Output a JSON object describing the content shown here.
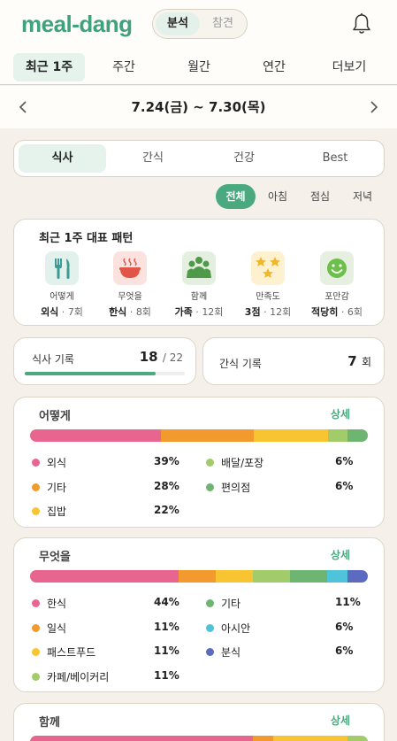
{
  "header": {
    "logo": "meal-dang",
    "mode_options": [
      "분석",
      "참견"
    ],
    "active_mode": "분석"
  },
  "period_tabs": [
    "최근 1주",
    "주간",
    "월간",
    "연간",
    "더보기"
  ],
  "date_range": "7.24(금) ~ 7.30(목)",
  "category_tabs": [
    "식사",
    "간식",
    "건강",
    "Best"
  ],
  "meal_filters": [
    "전체",
    "아침",
    "점심",
    "저녁"
  ],
  "pattern": {
    "title": "최근 1주 대표 패턴",
    "items": [
      {
        "label": "어떻게",
        "value": "외식",
        "count": "7회",
        "icon": "fork-knife-icon"
      },
      {
        "label": "무엇을",
        "value": "한식",
        "count": "8회",
        "icon": "soup-bowl-icon"
      },
      {
        "label": "함께",
        "value": "가족",
        "count": "12회",
        "icon": "family-icon"
      },
      {
        "label": "만족도",
        "value": "3점",
        "count": "12회",
        "icon": "stars-icon"
      },
      {
        "label": "포만감",
        "value": "적당히",
        "count": "6회",
        "icon": "smiley-icon"
      }
    ]
  },
  "meal_record": {
    "label": "식사 기록",
    "value": "18",
    "total": "/ 22",
    "progress": 0.82
  },
  "snack_record": {
    "label": "간식 기록",
    "value": "7",
    "unit": "회"
  },
  "colors": {
    "pink": "#e8658f",
    "orange": "#f29a2e",
    "yellow": "#f8c431",
    "lightgreen": "#a2cc6a",
    "green": "#6db570",
    "cyan": "#4fc3d9",
    "indigo": "#5c6bc0",
    "accent": "#4aa97f"
  },
  "sections": [
    {
      "title": "어떻게",
      "link": "상세",
      "items": [
        {
          "name": "외식",
          "pct": "39%",
          "value": 39,
          "color": "#e8658f"
        },
        {
          "name": "기타",
          "pct": "28%",
          "value": 28,
          "color": "#f29a2e"
        },
        {
          "name": "집밥",
          "pct": "22%",
          "value": 22,
          "color": "#f8c431"
        },
        {
          "name": "배달/포장",
          "pct": "6%",
          "value": 6,
          "color": "#a2cc6a"
        },
        {
          "name": "편의점",
          "pct": "6%",
          "value": 6,
          "color": "#6db570"
        }
      ]
    },
    {
      "title": "무엇을",
      "link": "상세",
      "items": [
        {
          "name": "한식",
          "pct": "44%",
          "value": 44,
          "color": "#e8658f"
        },
        {
          "name": "일식",
          "pct": "11%",
          "value": 11,
          "color": "#f29a2e"
        },
        {
          "name": "패스트푸드",
          "pct": "11%",
          "value": 11,
          "color": "#f8c431"
        },
        {
          "name": "카페/베이커리",
          "pct": "11%",
          "value": 11,
          "color": "#a2cc6a"
        },
        {
          "name": "기타",
          "pct": "11%",
          "value": 11,
          "color": "#6db570"
        },
        {
          "name": "아시안",
          "pct": "6%",
          "value": 6,
          "color": "#4fc3d9"
        },
        {
          "name": "분식",
          "pct": "6%",
          "value": 6,
          "color": "#5c6bc0"
        }
      ]
    },
    {
      "title": "함께",
      "link": "상세"
    }
  ]
}
